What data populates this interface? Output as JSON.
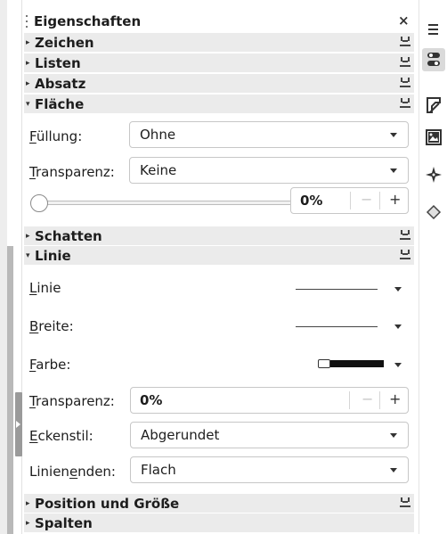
{
  "panel": {
    "title": "Eigenschaften",
    "close_label": "×"
  },
  "sections": {
    "zeichen": "Zeichen",
    "listen": "Listen",
    "absatz": "Absatz",
    "flaeche": "Fläche",
    "schatten": "Schatten",
    "linie": "Linie",
    "position": "Position und Größe",
    "spalten": "Spalten"
  },
  "flaeche": {
    "fuellung_label_accel": "F",
    "fuellung_label_rest": "üllung:",
    "fuellung_value": "Ohne",
    "transparenz_label_accel": "T",
    "transparenz_label_rest": "ransparenz:",
    "transparenz_value": "Keine",
    "slider_percent": "0%",
    "minus": "−",
    "plus": "+"
  },
  "linie": {
    "linie_label_accel": "L",
    "linie_label_rest": "inie",
    "breite_label_accel": "B",
    "breite_label_rest": "reite:",
    "farbe_label_accel": "F",
    "farbe_label_rest": "arbe:",
    "transparenz_label_accel": "T",
    "transparenz_label_rest": "ransparenz:",
    "transparenz_value": "0%",
    "minus": "−",
    "plus": "+",
    "eckenstil_label_accel": "E",
    "eckenstil_label_rest": "ckenstil:",
    "eckenstil_value": "Abgerundet",
    "linienenden_label_pre": "Linien",
    "linienenden_label_accel": "e",
    "linienenden_label_rest": "nden:",
    "linienenden_value": "Flach",
    "color_value": "#000000"
  },
  "sidebar": {
    "items": [
      "menu-icon",
      "properties-icon",
      "styles-icon",
      "gallery-icon",
      "navigator-icon",
      "shapes-icon"
    ]
  }
}
